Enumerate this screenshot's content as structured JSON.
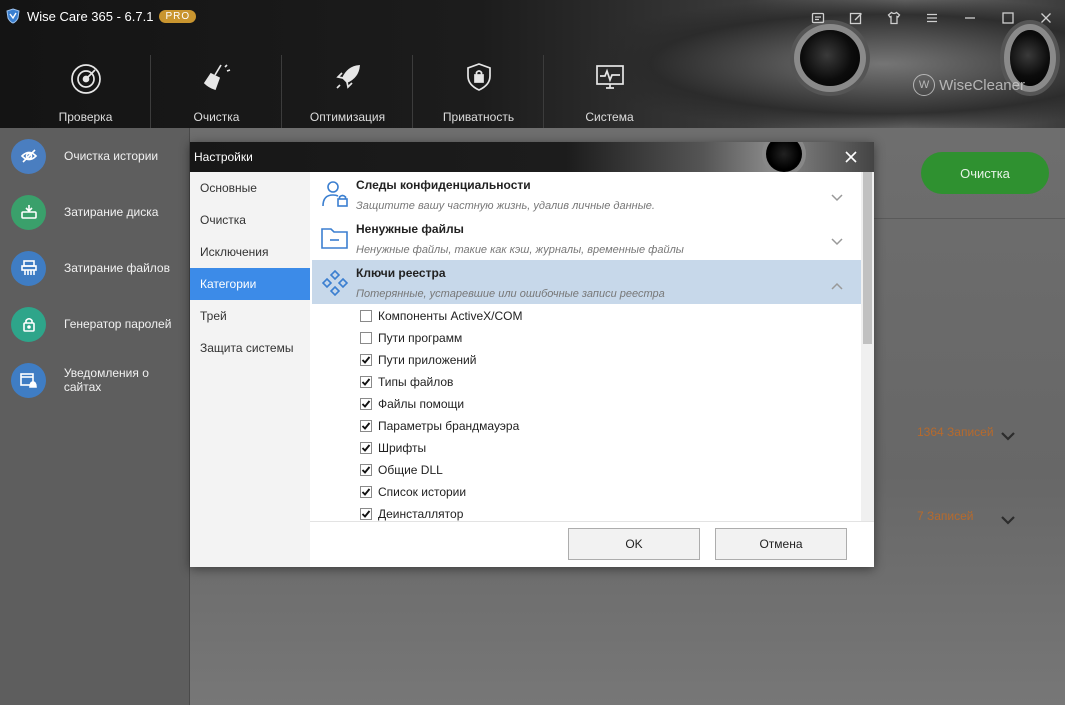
{
  "app": {
    "title": "Wise Care 365 - 6.7.1",
    "badge": "PRO",
    "brand": "WiseCleaner"
  },
  "main_tabs": [
    {
      "label": "Проверка",
      "icon": "radar-icon"
    },
    {
      "label": "Очистка",
      "icon": "broom-icon"
    },
    {
      "label": "Оптимизация",
      "icon": "rocket-icon"
    },
    {
      "label": "Приватность",
      "icon": "shield-lock-icon"
    },
    {
      "label": "Система",
      "icon": "monitor-pulse-icon"
    }
  ],
  "sidebar": {
    "items": [
      {
        "label": "Очистка истории",
        "icon": "eye-off-icon",
        "color": "#4a7ec0"
      },
      {
        "label": "Затирание диска",
        "icon": "disk-wipe-icon",
        "color": "#3aa06b"
      },
      {
        "label": "Затирание файлов",
        "icon": "shredder-icon",
        "color": "#3f7dc4"
      },
      {
        "label": "Генератор паролей",
        "icon": "password-lock-icon",
        "color": "#2ea58a"
      },
      {
        "label": "Уведомления о сайтах",
        "icon": "browser-bell-icon",
        "color": "#3f7dc4"
      }
    ]
  },
  "content": {
    "clean_button": "Очистка",
    "record_rows": [
      {
        "text": "1364 Записей"
      },
      {
        "text": "7 Записей"
      }
    ]
  },
  "dialog": {
    "title": "Настройки",
    "nav": [
      "Основные",
      "Очистка",
      "Исключения",
      "Категории",
      "Трей",
      "Защита системы"
    ],
    "active_nav_index": 3,
    "categories": [
      {
        "title": "Следы конфиденциальности",
        "description": "Защитите вашу частную жизнь, удалив личные данные.",
        "icon": "user-lock-icon",
        "expanded": false
      },
      {
        "title": "Ненужные файлы",
        "description": "Ненужные файлы, такие как кэш, журналы, временные файлы",
        "icon": "folder-icon",
        "expanded": false
      },
      {
        "title": "Ключи реестра",
        "description": "Потерянные, устаревшие или ошибочные записи реестра",
        "icon": "registry-cubes-icon",
        "expanded": true
      }
    ],
    "registry_items": [
      {
        "label": "Компоненты ActiveX/COM",
        "checked": false
      },
      {
        "label": "Пути программ",
        "checked": false
      },
      {
        "label": "Пути приложений",
        "checked": true
      },
      {
        "label": "Типы файлов",
        "checked": true
      },
      {
        "label": "Файлы помощи",
        "checked": true
      },
      {
        "label": "Параметры брандмауэра",
        "checked": true
      },
      {
        "label": "Шрифты",
        "checked": true
      },
      {
        "label": "Общие DLL",
        "checked": true
      },
      {
        "label": "Список истории",
        "checked": true
      },
      {
        "label": "Деинсталлятор",
        "checked": true
      }
    ],
    "ok_label": "OK",
    "cancel_label": "Отмена"
  },
  "colors": {
    "accent_blue": "#3c8be8",
    "clean_green": "#2f9130",
    "records_orange": "#b66a2d"
  }
}
